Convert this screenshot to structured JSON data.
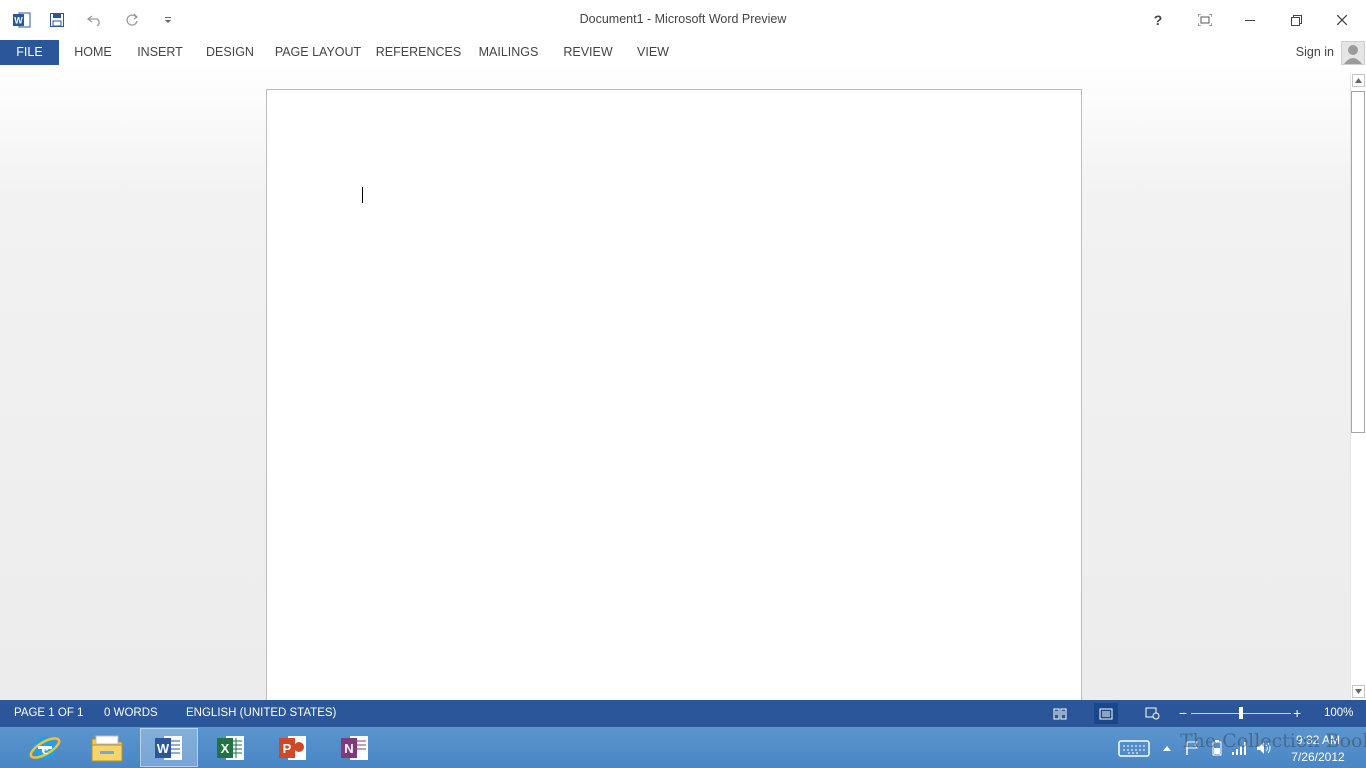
{
  "window": {
    "title": "Document1 - Microsoft Word Preview"
  },
  "qat": {
    "app_icon": "word-icon",
    "save_icon": "save-icon",
    "undo_icon": "undo-icon",
    "redo_icon": "redo-icon",
    "customize_icon": "chevron-down-icon"
  },
  "window_controls": {
    "help": "?",
    "items": [
      "help-icon",
      "fullscreen-icon",
      "minimize-icon",
      "restore-icon",
      "close-icon"
    ]
  },
  "ribbon": {
    "tabs": [
      "FILE",
      "HOME",
      "INSERT",
      "DESIGN",
      "PAGE LAYOUT",
      "REFERENCES",
      "MAILINGS",
      "REVIEW",
      "VIEW"
    ],
    "sign_in": "Sign in"
  },
  "status": {
    "page": "PAGE 1 OF 1",
    "words": "0 WORDS",
    "language": "ENGLISH (UNITED STATES)",
    "zoom": "100%",
    "zoom_percent": 100,
    "views": [
      "read-mode-icon",
      "print-layout-icon",
      "web-layout-icon"
    ],
    "active_view": "print-layout-icon"
  },
  "taskbar": {
    "apps": [
      "internet-explorer-icon",
      "file-explorer-icon",
      "word-icon",
      "excel-icon",
      "powerpoint-icon",
      "onenote-icon"
    ],
    "active_app": "word-icon",
    "time": "9:32 AM",
    "date": "7/26/2012",
    "watermark": "The Collection Book"
  },
  "colors": {
    "word_blue": "#2b579a",
    "taskbar_blue": "#4a86c5",
    "excel_green": "#217346",
    "powerpoint_red": "#d24726",
    "onenote_purple": "#80397b"
  }
}
